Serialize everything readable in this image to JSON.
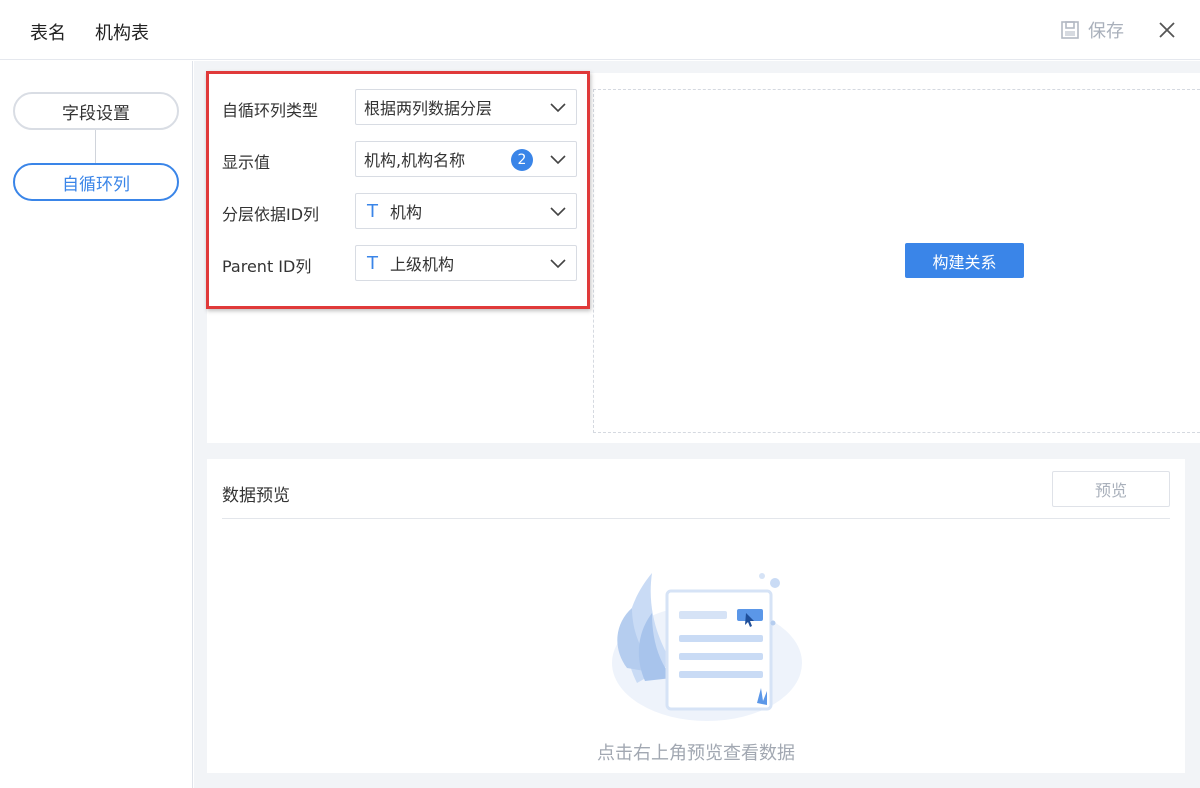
{
  "header": {
    "table_name_label": "表名",
    "table_name_value": "机构表",
    "save_label": "保存"
  },
  "steps": [
    {
      "label": "字段设置",
      "active": false
    },
    {
      "label": "自循环列",
      "active": true
    }
  ],
  "form": {
    "type": {
      "label": "自循环列类型",
      "value": "根据两列数据分层"
    },
    "display": {
      "label": "显示值",
      "value": "机构,机构名称",
      "badge": "2"
    },
    "layer_id": {
      "label": "分层依据ID列",
      "type_icon": "T",
      "value": "机构"
    },
    "parent_id": {
      "label": "Parent ID列",
      "type_icon": "T",
      "value": "上级机构"
    }
  },
  "build_button": "构建关系",
  "preview": {
    "title": "数据预览",
    "button": "预览",
    "empty_text": "点击右上角预览查看数据"
  },
  "colors": {
    "accent": "#3a85e8",
    "highlight_box": "#e03a3a",
    "muted_text": "#a9b0bb"
  }
}
